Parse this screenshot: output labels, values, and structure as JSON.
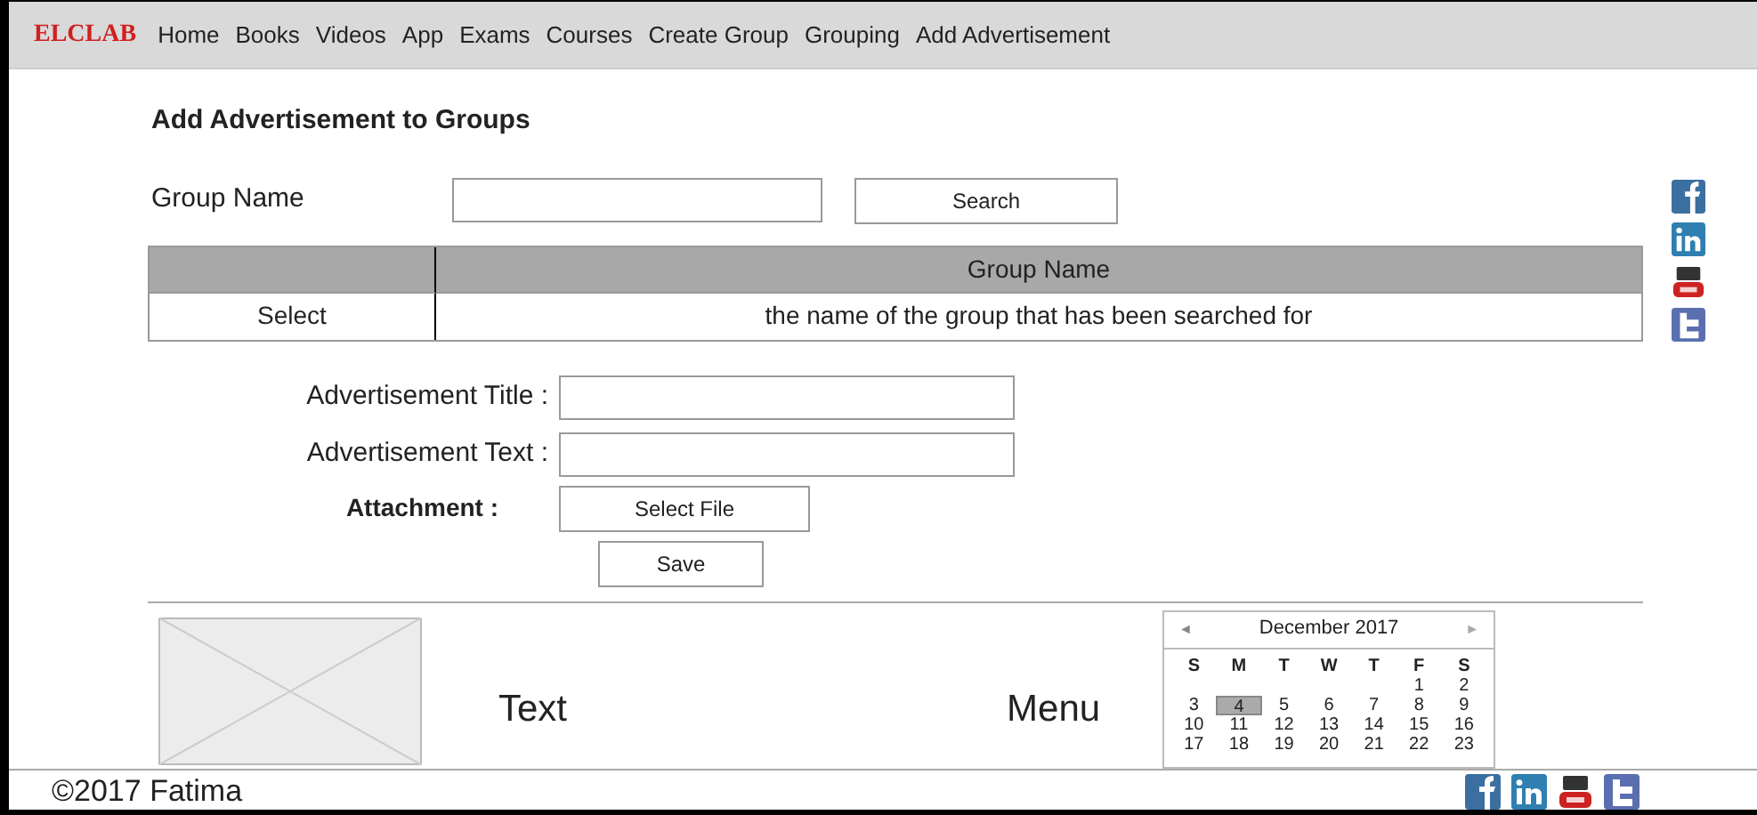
{
  "navbar": {
    "brand": "ELCLAB",
    "items": [
      {
        "label": "Home"
      },
      {
        "label": "Books"
      },
      {
        "label": "Videos"
      },
      {
        "label": "App"
      },
      {
        "label": "Exams"
      },
      {
        "label": "Courses"
      },
      {
        "label": "Create Group"
      },
      {
        "label": "Grouping"
      },
      {
        "label": "Add Advertisement"
      }
    ]
  },
  "heading": "Add Advertisement to Groups",
  "search": {
    "label": "Group Name",
    "button": "Search"
  },
  "table": {
    "columns": [
      {
        "label": "Group Name"
      }
    ],
    "rows": [
      {
        "select": "Select",
        "name": "the name of the group that has been searched for"
      }
    ]
  },
  "form": {
    "title_label": "Advertisement Title :",
    "text_label": "Advertisement Text :",
    "attachment_label": "Attachment :",
    "file_button": "Select File",
    "save_button": "Save"
  },
  "side_icons": [
    {
      "kind": "f"
    },
    {
      "kind": "in"
    },
    {
      "kind": "yt"
    },
    {
      "kind": "t"
    }
  ],
  "footer_band": {
    "image": {
      "kind": "placeholder"
    },
    "text": "Text",
    "menu": "Menu"
  },
  "calendar": {
    "month": "December 2017",
    "prev": "◄",
    "next": "►",
    "weekdays": [
      "S",
      "M",
      "T",
      "W",
      "T",
      "F",
      "S"
    ],
    "weeks": [
      [
        {
          "day": "1",
          "selected": false
        },
        {
          "day": "2",
          "selected": false
        }
      ],
      [
        {
          "day": "3",
          "selected": false
        },
        {
          "day": "4",
          "selected": true
        },
        {
          "day": "5",
          "selected": false
        },
        {
          "day": "6",
          "selected": false
        },
        {
          "day": "7",
          "selected": false
        },
        {
          "day": "8",
          "selected": false
        },
        {
          "day": "9",
          "selected": false
        }
      ],
      [
        {
          "day": "10",
          "selected": false
        },
        {
          "day": "11",
          "selected": false
        },
        {
          "day": "12",
          "selected": false
        },
        {
          "day": "13",
          "selected": false
        },
        {
          "day": "14",
          "selected": false
        },
        {
          "day": "15",
          "selected": false
        },
        {
          "day": "16",
          "selected": false
        }
      ],
      [
        {
          "day": "17",
          "selected": false
        },
        {
          "day": "18",
          "selected": false
        },
        {
          "day": "19",
          "selected": false
        },
        {
          "day": "20",
          "selected": false
        },
        {
          "day": "21",
          "selected": false
        },
        {
          "day": "22",
          "selected": false
        },
        {
          "day": "23",
          "selected": false
        }
      ]
    ]
  },
  "footer": {
    "copyright": "©2017 Fatima",
    "icons": [
      {
        "kind": "f"
      },
      {
        "kind": "in"
      },
      {
        "kind": "yt"
      },
      {
        "kind": "t"
      }
    ]
  }
}
